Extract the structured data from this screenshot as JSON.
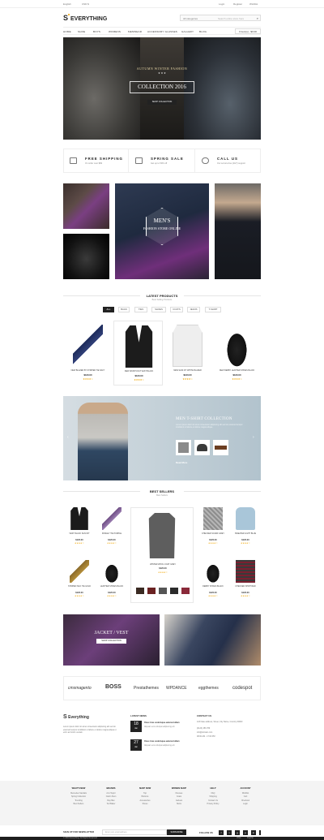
{
  "topbar": {
    "lang": "English",
    "currency": "USD $",
    "account": "Login",
    "register": "Register",
    "wishlist": "Wishlist"
  },
  "header": {
    "logo": "Everything",
    "search_category": "All categories",
    "search_placeholder": "Search entire store here",
    "cart": "0 item(s) - $0.00"
  },
  "nav": [
    "HOME",
    "SHOE",
    "BOYS",
    "WOMENS",
    "MENWEAR",
    "ACCESSORY GLASSES",
    "GALLERY",
    "BLOG"
  ],
  "hero": {
    "subtitle": "AUTUMN WINTER FASHION",
    "title": "COLLECTION 2016",
    "button": "SHOP COLLECTION"
  },
  "features": [
    {
      "title": "FREE SHIPPING",
      "desc": "On order over $99"
    },
    {
      "title": "SPRING SALE",
      "desc": "Get up to 50% off"
    },
    {
      "title": "CALL US",
      "desc": "Our service line (24/7) support"
    }
  ],
  "promo": {
    "title": "MEN'S",
    "subtitle": "FASHION STORE ONLINE"
  },
  "latest": {
    "title": "LATEST PRODUCTS",
    "sub": "Best Selling Products",
    "tabs": [
      "ALL",
      "BAGS",
      "TIES",
      "SHOES",
      "COATS",
      "JEANS",
      "T-SHIRT"
    ]
  },
  "products": [
    {
      "name": "NEW BLAZER BY STRIPED TIE NAVY",
      "price": "$120.00",
      "stars": "★★★★☆"
    },
    {
      "name": "NEW WAISTCOAT VEST BLACK",
      "price": "$120.00",
      "stars": "★★★★☆"
    },
    {
      "name": "NEW SLIM FIT WHITE BLAZER",
      "price": "$120.00",
      "stars": "★★★★☆"
    },
    {
      "name": "NEW DERBY LEATHER SHOES BLACK",
      "price": "$120.00",
      "stars": "★★★★☆"
    }
  ],
  "banner": {
    "title": "MEN T-SHIRT COLLECTION",
    "text": "Lorem ipsum dolor sit amet consectetur adipiscing elit sed do eiusmod tempor incididunt ut labore et dolore magna aliqua.",
    "more": "Read More"
  },
  "bestsellers": {
    "title": "BEST SELLERS",
    "sub": "Best Sellers"
  },
  "bs_items": [
    {
      "name": "VEST BLACK SLIM FIT",
      "price": "$120.00",
      "stars": "★★★★☆"
    },
    {
      "name": "PAISLEY TIE PURPLE",
      "price": "$120.00",
      "stars": "★★★★☆"
    },
    {
      "name": "STRIPED SILK TIE GOLD",
      "price": "$120.00",
      "stars": "★★★★☆"
    },
    {
      "name": "LEATHER SHOES BLACK",
      "price": "$120.00",
      "stars": "★★★★☆"
    },
    {
      "name": "WINTER WOOL COAT GREY",
      "price": "$120.00",
      "stars": "★★★★☆"
    },
    {
      "name": "CHECKED SCARF GREY",
      "price": "$120.00",
      "stars": "★★★★☆"
    },
    {
      "name": "SWEATER LIGHT BLUE",
      "price": "$120.00",
      "stars": "★★★★☆"
    },
    {
      "name": "DERBY SHOES BLACK",
      "price": "$120.00",
      "stars": "★★★★☆"
    },
    {
      "name": "CHECKED SHIRT RED",
      "price": "$120.00",
      "stars": "★★★★☆"
    }
  ],
  "jacket": {
    "title": "JACKET / VEST",
    "button": "SHOP COLLECTION"
  },
  "brands": [
    "cmsmagento",
    "BOSS",
    "Prestathemes",
    "WPDANCE",
    "eggthemes",
    "codespot"
  ],
  "footer_about": {
    "logo": "Everything",
    "text": "Lorem ipsum dolor sit amet consectetur adipiscing elit sed do eiusmod tempor incididunt ut labore et dolore magna aliqua ut enim ad minim veniam."
  },
  "latest_news": {
    "title": "LATEST NEWS",
    "items": [
      {
        "day": "18",
        "month": "Jan",
        "title": "Ones ricas scelerisque euismod ullam",
        "text": "Aliquam erat volutpat adipiscing elit"
      },
      {
        "day": "27",
        "month": "Jan",
        "title": "Ones ricas scelerisque euismod ullam",
        "text": "Aliquam erat volutpat adipiscing elit"
      }
    ]
  },
  "contact": {
    "title": "CONTACT US",
    "address": "123 Fake address, Street, City Name, Country 00000",
    "phone": "(0123) 456 789",
    "email": "info@domain.com",
    "hours": "08:00 AM - 17:00 PM"
  },
  "footer_cols": [
    {
      "head": "WHAT'S NEW",
      "items": [
        "Mercedes Sandals",
        "Spring Collection",
        "Trending",
        "Best Sellers"
      ]
    },
    {
      "head": "BRANDS",
      "items": [
        "Ann Taylor",
        "Calvin Klein",
        "Ray Ban",
        "Ted Baker"
      ]
    },
    {
      "head": "SHOP NOW",
      "items": [
        "Top",
        "Bottoms",
        "Accessories",
        "Shoes"
      ]
    },
    {
      "head": "WOMEN SHOP",
      "items": [
        "Dresses",
        "Coats",
        "Jackets",
        "Skirts"
      ]
    },
    {
      "head": "HELP",
      "items": [
        "FAQ",
        "Shipping",
        "Contact Us",
        "Privacy Policy"
      ]
    },
    {
      "head": "ACCOUNT",
      "items": [
        "Wishlist",
        "Cart",
        "Checkout",
        "Login"
      ]
    }
  ],
  "newsletter": {
    "label": "SIGN UP FOR NEWSLETTER",
    "placeholder": "Enter your email address",
    "button": "SUBSCRIBE",
    "follow": "FOLLOW US"
  },
  "social": [
    "f",
    "t",
    "g",
    "p",
    "in",
    "y"
  ],
  "copyright": "© 2016 Everything. All Rights Reserved",
  "payments": [
    "VISA",
    "PayPal"
  ]
}
